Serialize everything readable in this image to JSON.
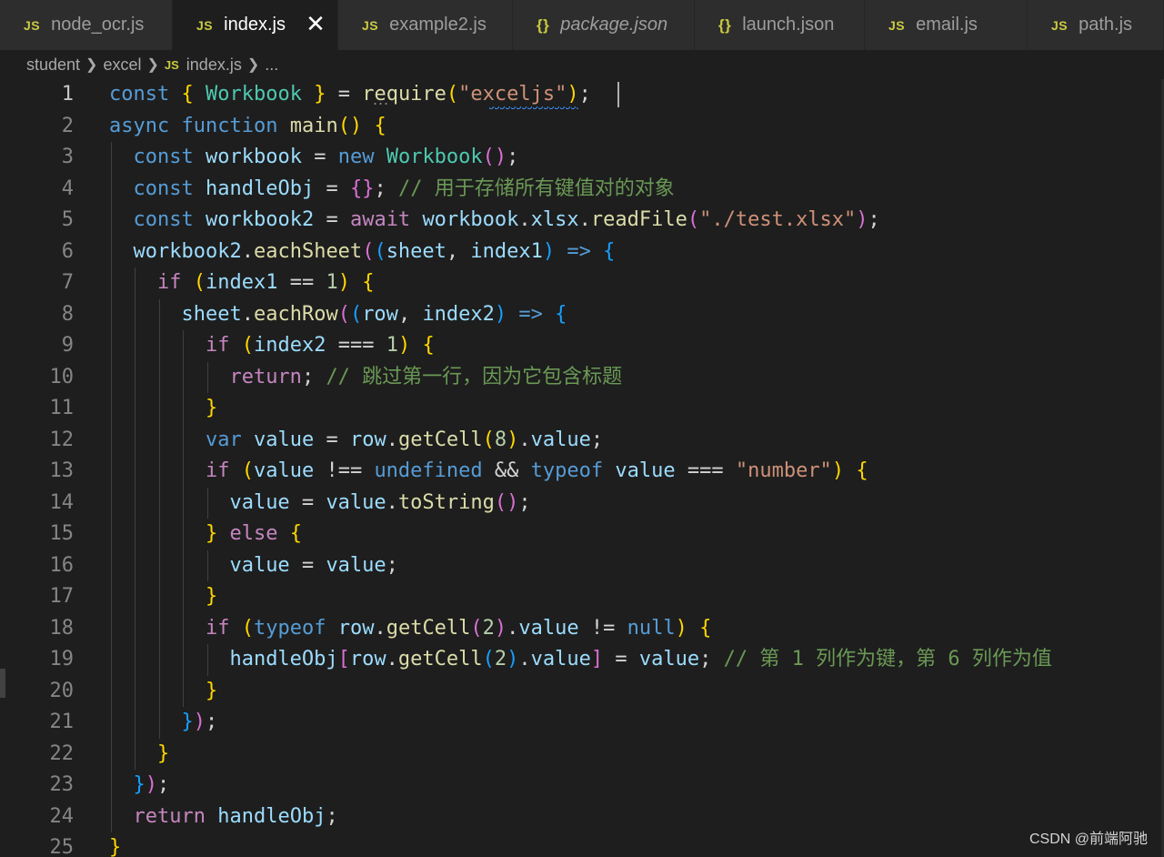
{
  "tabs": [
    {
      "icon": "JS",
      "label": "node_ocr.js",
      "active": false,
      "italic": false
    },
    {
      "icon": "JS",
      "label": "index.js",
      "active": true,
      "italic": false,
      "close": "✕"
    },
    {
      "icon": "JS",
      "label": "example2.js",
      "active": false,
      "italic": false
    },
    {
      "icon": "{}",
      "label": "package.json",
      "active": false,
      "italic": true
    },
    {
      "icon": "{}",
      "label": "launch.json",
      "active": false,
      "italic": false
    },
    {
      "icon": "JS",
      "label": "email.js",
      "active": false,
      "italic": false
    },
    {
      "icon": "JS",
      "label": "path.js",
      "active": false,
      "italic": false
    }
  ],
  "breadcrumb": {
    "items": [
      "student",
      "excel"
    ],
    "file_icon": "JS",
    "file": "index.js",
    "more": "..."
  },
  "editor": {
    "current_line": 1,
    "lines": [
      {
        "n": "1",
        "tokens": [
          [
            "k",
            "const"
          ],
          [
            "p",
            " "
          ],
          [
            "b1",
            "{"
          ],
          [
            "p",
            " "
          ],
          [
            "cl",
            "Workbook"
          ],
          [
            "p",
            " "
          ],
          [
            "b1",
            "}"
          ],
          [
            "p",
            " = "
          ],
          [
            "f",
            "require"
          ],
          [
            "b1",
            "("
          ],
          [
            "s",
            "\"exceljs\""
          ],
          [
            "b1",
            ")"
          ],
          [
            "p",
            ";"
          ]
        ]
      },
      {
        "n": "2",
        "tokens": [
          [
            "k",
            "async"
          ],
          [
            "p",
            " "
          ],
          [
            "k",
            "function"
          ],
          [
            "p",
            " "
          ],
          [
            "f",
            "main"
          ],
          [
            "b1",
            "()"
          ],
          [
            "p",
            " "
          ],
          [
            "b1",
            "{"
          ]
        ]
      },
      {
        "n": "3",
        "tokens": [
          [
            "p",
            "  "
          ],
          [
            "k",
            "const"
          ],
          [
            "p",
            " "
          ],
          [
            "v",
            "workbook"
          ],
          [
            "p",
            " = "
          ],
          [
            "k",
            "new"
          ],
          [
            "p",
            " "
          ],
          [
            "cl",
            "Workbook"
          ],
          [
            "b2",
            "()"
          ],
          [
            "p",
            ";"
          ]
        ]
      },
      {
        "n": "4",
        "tokens": [
          [
            "p",
            "  "
          ],
          [
            "k",
            "const"
          ],
          [
            "p",
            " "
          ],
          [
            "v",
            "handleObj"
          ],
          [
            "p",
            " = "
          ],
          [
            "b2",
            "{}"
          ],
          [
            "p",
            "; "
          ],
          [
            "cm",
            "// 用于存储所有键值对的对象"
          ]
        ]
      },
      {
        "n": "5",
        "tokens": [
          [
            "p",
            "  "
          ],
          [
            "k",
            "const"
          ],
          [
            "p",
            " "
          ],
          [
            "v",
            "workbook2"
          ],
          [
            "p",
            " = "
          ],
          [
            "c",
            "await"
          ],
          [
            "p",
            " "
          ],
          [
            "v",
            "workbook"
          ],
          [
            "p",
            "."
          ],
          [
            "v",
            "xlsx"
          ],
          [
            "p",
            "."
          ],
          [
            "f",
            "readFile"
          ],
          [
            "b2",
            "("
          ],
          [
            "s",
            "\"./test.xlsx\""
          ],
          [
            "b2",
            ")"
          ],
          [
            "p",
            ";"
          ]
        ]
      },
      {
        "n": "6",
        "tokens": [
          [
            "p",
            "  "
          ],
          [
            "v",
            "workbook2"
          ],
          [
            "p",
            "."
          ],
          [
            "f",
            "eachSheet"
          ],
          [
            "b2",
            "("
          ],
          [
            "b3",
            "("
          ],
          [
            "v",
            "sheet"
          ],
          [
            "p",
            ", "
          ],
          [
            "v",
            "index1"
          ],
          [
            "b3",
            ")"
          ],
          [
            "p",
            " "
          ],
          [
            "k",
            "=>"
          ],
          [
            "p",
            " "
          ],
          [
            "b3",
            "{"
          ]
        ]
      },
      {
        "n": "7",
        "tokens": [
          [
            "p",
            "    "
          ],
          [
            "c",
            "if"
          ],
          [
            "p",
            " "
          ],
          [
            "b1",
            "("
          ],
          [
            "v",
            "index1"
          ],
          [
            "p",
            " == "
          ],
          [
            "n",
            "1"
          ],
          [
            "b1",
            ")"
          ],
          [
            "p",
            " "
          ],
          [
            "b1",
            "{"
          ]
        ]
      },
      {
        "n": "8",
        "tokens": [
          [
            "p",
            "      "
          ],
          [
            "v",
            "sheet"
          ],
          [
            "p",
            "."
          ],
          [
            "f",
            "eachRow"
          ],
          [
            "b2",
            "("
          ],
          [
            "b3",
            "("
          ],
          [
            "v",
            "row"
          ],
          [
            "p",
            ", "
          ],
          [
            "v",
            "index2"
          ],
          [
            "b3",
            ")"
          ],
          [
            "p",
            " "
          ],
          [
            "k",
            "=>"
          ],
          [
            "p",
            " "
          ],
          [
            "b3",
            "{"
          ]
        ]
      },
      {
        "n": "9",
        "tokens": [
          [
            "p",
            "        "
          ],
          [
            "c",
            "if"
          ],
          [
            "p",
            " "
          ],
          [
            "b1",
            "("
          ],
          [
            "v",
            "index2"
          ],
          [
            "p",
            " === "
          ],
          [
            "n",
            "1"
          ],
          [
            "b1",
            ")"
          ],
          [
            "p",
            " "
          ],
          [
            "b1",
            "{"
          ]
        ]
      },
      {
        "n": "10",
        "tokens": [
          [
            "p",
            "          "
          ],
          [
            "c",
            "return"
          ],
          [
            "p",
            "; "
          ],
          [
            "cm",
            "// 跳过第一行，因为它包含标题"
          ]
        ]
      },
      {
        "n": "11",
        "tokens": [
          [
            "p",
            "        "
          ],
          [
            "b1",
            "}"
          ]
        ]
      },
      {
        "n": "12",
        "tokens": [
          [
            "p",
            "        "
          ],
          [
            "k",
            "var"
          ],
          [
            "p",
            " "
          ],
          [
            "v",
            "value"
          ],
          [
            "p",
            " = "
          ],
          [
            "v",
            "row"
          ],
          [
            "p",
            "."
          ],
          [
            "f",
            "getCell"
          ],
          [
            "b1",
            "("
          ],
          [
            "n",
            "8"
          ],
          [
            "b1",
            ")"
          ],
          [
            "p",
            "."
          ],
          [
            "v",
            "value"
          ],
          [
            "p",
            ";"
          ]
        ]
      },
      {
        "n": "13",
        "tokens": [
          [
            "p",
            "        "
          ],
          [
            "c",
            "if"
          ],
          [
            "p",
            " "
          ],
          [
            "b1",
            "("
          ],
          [
            "v",
            "value"
          ],
          [
            "p",
            " !== "
          ],
          [
            "k",
            "undefined"
          ],
          [
            "p",
            " && "
          ],
          [
            "k",
            "typeof"
          ],
          [
            "p",
            " "
          ],
          [
            "v",
            "value"
          ],
          [
            "p",
            " === "
          ],
          [
            "s",
            "\"number\""
          ],
          [
            "b1",
            ")"
          ],
          [
            "p",
            " "
          ],
          [
            "b1",
            "{"
          ]
        ]
      },
      {
        "n": "14",
        "tokens": [
          [
            "p",
            "          "
          ],
          [
            "v",
            "value"
          ],
          [
            "p",
            " = "
          ],
          [
            "v",
            "value"
          ],
          [
            "p",
            "."
          ],
          [
            "f",
            "toString"
          ],
          [
            "b2",
            "()"
          ],
          [
            "p",
            ";"
          ]
        ]
      },
      {
        "n": "15",
        "tokens": [
          [
            "p",
            "        "
          ],
          [
            "b1",
            "}"
          ],
          [
            "p",
            " "
          ],
          [
            "c",
            "else"
          ],
          [
            "p",
            " "
          ],
          [
            "b1",
            "{"
          ]
        ]
      },
      {
        "n": "16",
        "tokens": [
          [
            "p",
            "          "
          ],
          [
            "v",
            "value"
          ],
          [
            "p",
            " = "
          ],
          [
            "v",
            "value"
          ],
          [
            "p",
            ";"
          ]
        ]
      },
      {
        "n": "17",
        "tokens": [
          [
            "p",
            "        "
          ],
          [
            "b1",
            "}"
          ]
        ]
      },
      {
        "n": "18",
        "tokens": [
          [
            "p",
            "        "
          ],
          [
            "c",
            "if"
          ],
          [
            "p",
            " "
          ],
          [
            "b1",
            "("
          ],
          [
            "k",
            "typeof"
          ],
          [
            "p",
            " "
          ],
          [
            "v",
            "row"
          ],
          [
            "p",
            "."
          ],
          [
            "f",
            "getCell"
          ],
          [
            "b2",
            "("
          ],
          [
            "n",
            "2"
          ],
          [
            "b2",
            ")"
          ],
          [
            "p",
            "."
          ],
          [
            "v",
            "value"
          ],
          [
            "p",
            " != "
          ],
          [
            "k",
            "null"
          ],
          [
            "b1",
            ")"
          ],
          [
            "p",
            " "
          ],
          [
            "b1",
            "{"
          ]
        ]
      },
      {
        "n": "19",
        "tokens": [
          [
            "p",
            "          "
          ],
          [
            "v",
            "handleObj"
          ],
          [
            "b2",
            "["
          ],
          [
            "v",
            "row"
          ],
          [
            "p",
            "."
          ],
          [
            "f",
            "getCell"
          ],
          [
            "b3",
            "("
          ],
          [
            "n",
            "2"
          ],
          [
            "b3",
            ")"
          ],
          [
            "p",
            "."
          ],
          [
            "v",
            "value"
          ],
          [
            "b2",
            "]"
          ],
          [
            "p",
            " = "
          ],
          [
            "v",
            "value"
          ],
          [
            "p",
            "; "
          ],
          [
            "cm",
            "// 第 1 列作为键，第 6 列作为值"
          ]
        ]
      },
      {
        "n": "20",
        "tokens": [
          [
            "p",
            "        "
          ],
          [
            "b1",
            "}"
          ]
        ]
      },
      {
        "n": "21",
        "tokens": [
          [
            "p",
            "      "
          ],
          [
            "b3",
            "}"
          ],
          [
            "b2",
            ")"
          ],
          [
            "p",
            ";"
          ]
        ]
      },
      {
        "n": "22",
        "tokens": [
          [
            "p",
            "    "
          ],
          [
            "b1",
            "}"
          ]
        ]
      },
      {
        "n": "23",
        "tokens": [
          [
            "p",
            "  "
          ],
          [
            "b3",
            "}"
          ],
          [
            "b2",
            ")"
          ],
          [
            "p",
            ";"
          ]
        ]
      },
      {
        "n": "24",
        "tokens": [
          [
            "p",
            "  "
          ],
          [
            "c",
            "return"
          ],
          [
            "p",
            " "
          ],
          [
            "v",
            "handleObj"
          ],
          [
            "p",
            ";"
          ]
        ]
      },
      {
        "n": "25",
        "tokens": [
          [
            "b1",
            "}"
          ]
        ]
      }
    ]
  },
  "watermark": "CSDN @前端阿驰",
  "hover_dots": "..."
}
